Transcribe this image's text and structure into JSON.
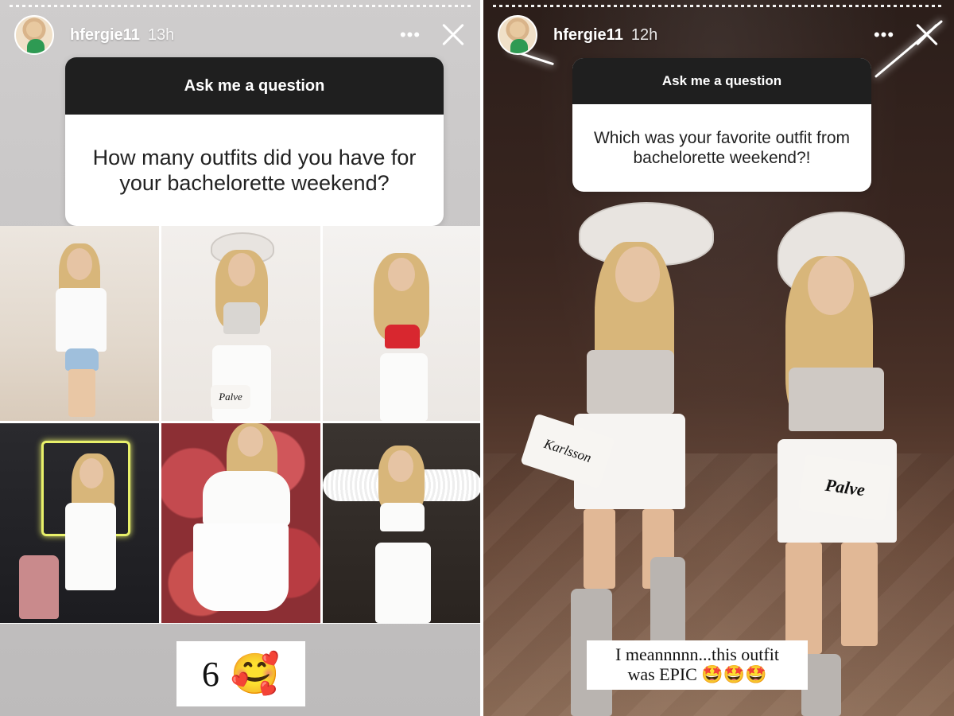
{
  "left_story": {
    "username": "hfergie11",
    "time": "13h",
    "question_title": "Ask me a question",
    "question_text": "How many outfits did you have for your bachelorette weekend?",
    "answer_number": "6",
    "answer_emoji": "🥰",
    "photo_texts": {
      "purse": "Palve"
    }
  },
  "right_story": {
    "username": "hfergie11",
    "time": "12h",
    "question_title": "Ask me a question",
    "question_text": "Which was your favorite outfit from bachelorette weekend?!",
    "answer_line1": "I meannnnn...this outfit",
    "answer_line2": "was EPIC 🤩🤩🤩",
    "purse_left": "Karlsson",
    "purse_right": "Palve"
  },
  "icons": {
    "more": "more-options-icon",
    "close": "close-icon"
  },
  "colors": {
    "question_header_bg": "#1f1f1f",
    "sticker_bg": "#ffffff",
    "left_bg": "#cfcdcd",
    "right_bg": "#3a2620"
  }
}
